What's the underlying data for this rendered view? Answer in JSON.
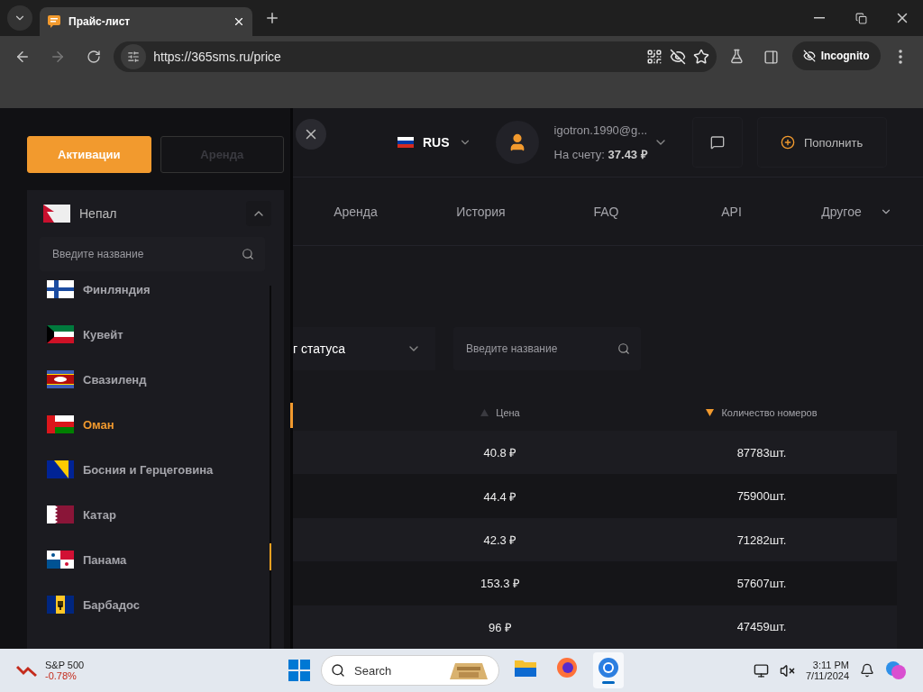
{
  "browser": {
    "tabs": [
      {
        "title": "Прайс-лист",
        "selected": true
      }
    ],
    "url": "https://365sms.ru/price",
    "profile": "Incognito"
  },
  "drawer": {
    "mode_tabs": [
      {
        "label": "Активации",
        "selected": true
      },
      {
        "label": "Аренда",
        "selected": false
      }
    ],
    "country_select": {
      "value": "Непал",
      "kind": "nepal",
      "expanded": true
    },
    "search": {
      "placeholder": "Введите название"
    },
    "countries": [
      {
        "name": "Финляндия",
        "kind": "finland",
        "selected": false
      },
      {
        "name": "Кувейт",
        "kind": "kuwait",
        "selected": false
      },
      {
        "name": "Свазиленд",
        "kind": "eswatini",
        "selected": false
      },
      {
        "name": "Оман",
        "kind": "oman",
        "selected": true
      },
      {
        "name": "Босния и Герцеговина",
        "kind": "bosnia",
        "selected": false
      },
      {
        "name": "Катар",
        "kind": "qatar",
        "selected": false
      },
      {
        "name": "Панама",
        "kind": "panama",
        "selected": false
      },
      {
        "name": "Барбадос",
        "kind": "barbados",
        "selected": false
      }
    ]
  },
  "header": {
    "language": {
      "code": "RUS",
      "kind": "russia"
    },
    "account": {
      "email": "igotron.1990@g...",
      "balance_label": "На счету:",
      "balance": "37.43 ₽"
    },
    "topup": "Пополнить"
  },
  "nav": [
    {
      "label": "Аренда",
      "dropdown": false
    },
    {
      "label": "История",
      "dropdown": false
    },
    {
      "label": "FAQ",
      "dropdown": false
    },
    {
      "label": "API",
      "dropdown": false
    },
    {
      "label": "Другое",
      "dropdown": true
    }
  ],
  "filters": {
    "status_select": {
      "value": "г статуса"
    },
    "search": {
      "placeholder": "Введите название"
    }
  },
  "table": {
    "columns": [
      {
        "label": "Цена",
        "sorted": false
      },
      {
        "label": "Количество номеров",
        "sorted": true
      }
    ],
    "rows": [
      {
        "price": "40.8 ₽",
        "count": "87783шт."
      },
      {
        "price": "44.4 ₽",
        "count": "75900шт."
      },
      {
        "price": "42.3 ₽",
        "count": "71282шт."
      },
      {
        "price": "153.3 ₽",
        "count": "57607шт."
      },
      {
        "price": "96 ₽",
        "count": "47459шт."
      }
    ]
  },
  "taskbar": {
    "stock": {
      "name": "S&P 500",
      "change": "-0.78%"
    },
    "search": {
      "placeholder": "Search"
    },
    "apps": [
      {
        "kind": "folder",
        "selected": false
      },
      {
        "kind": "firefox",
        "selected": false
      },
      {
        "kind": "chrome",
        "selected": true
      }
    ],
    "time": "3:11 PM",
    "date": "7/11/2024"
  }
}
